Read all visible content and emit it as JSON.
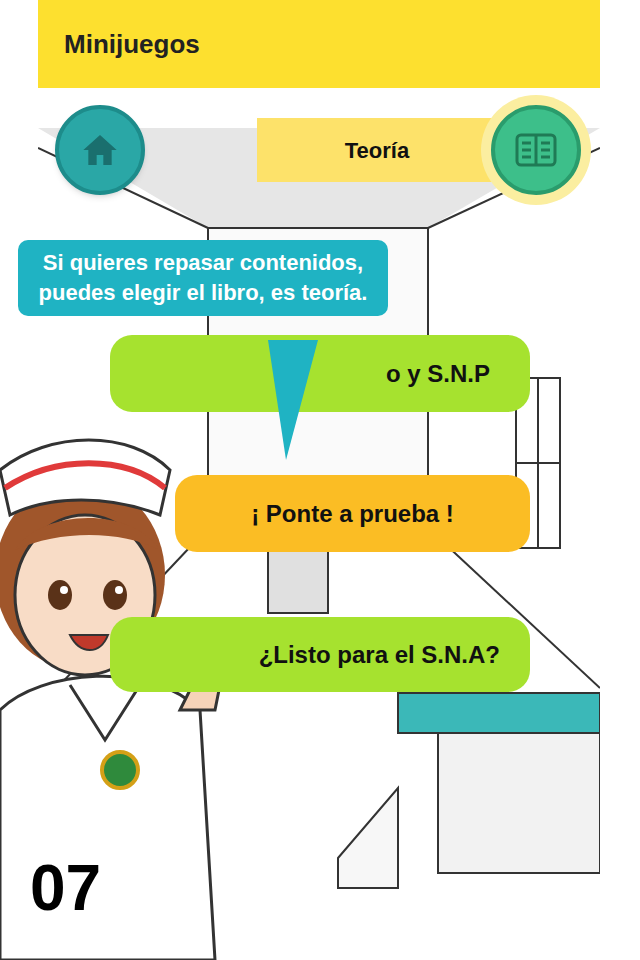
{
  "header": {
    "title": "Minijuegos"
  },
  "toolbar": {
    "theory_label": "Teoría",
    "book_button": {
      "highlighted": true
    }
  },
  "bubble": {
    "text": "Si quieres repasar contenidos, puedes elegir el libro, es teoría."
  },
  "menu_buttons": [
    {
      "label": "o y S.N.P",
      "color": "#a6e22f"
    },
    {
      "label": "¡ Ponte a prueba !",
      "color": "#fbbd24"
    },
    {
      "label": "¿Listo para el S.N.A?",
      "color": "#a6e22f"
    }
  ],
  "page_number": "07"
}
